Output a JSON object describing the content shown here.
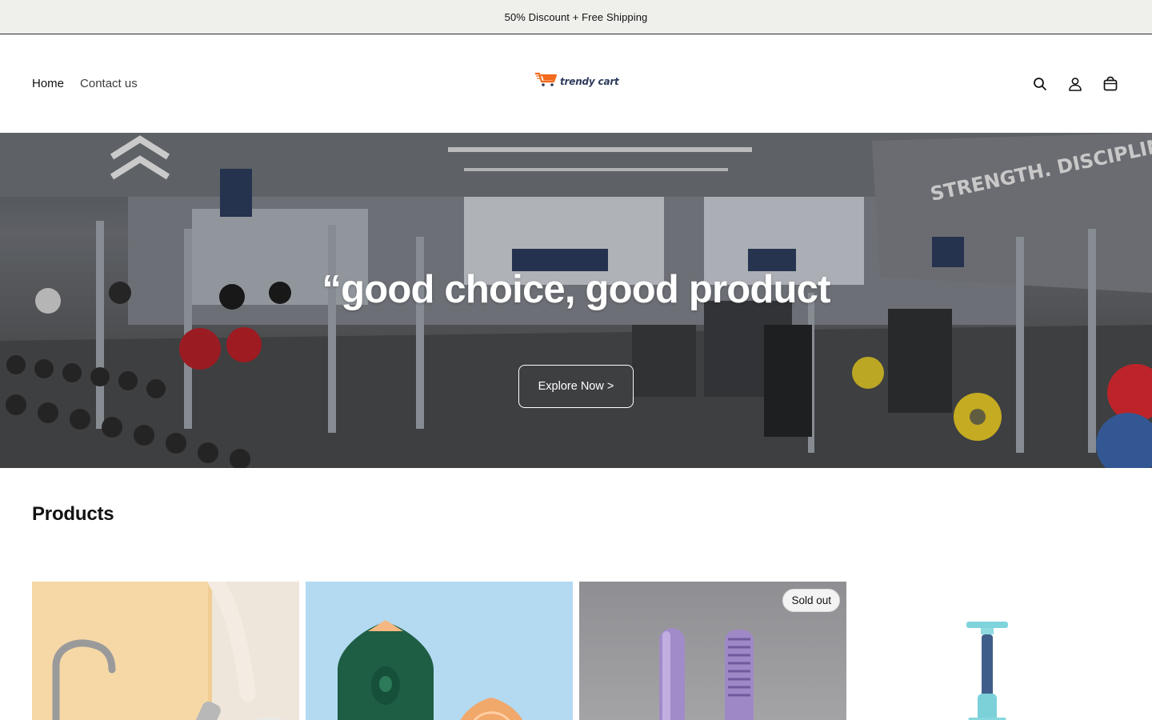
{
  "announcement": {
    "text": "50% Discount + Free Shipping"
  },
  "header": {
    "nav": [
      {
        "label": "Home"
      },
      {
        "label": "Contact us"
      }
    ],
    "logo_text": "trendy cart",
    "icons": [
      "search-icon",
      "account-icon",
      "cart-icon"
    ]
  },
  "hero": {
    "heading": "“good choice, good product",
    "button_label": "Explore Now >"
  },
  "products": {
    "title": "Products",
    "items": [
      {
        "image": "kitchen-sink-cleaning-product",
        "badge": ""
      },
      {
        "image": "green-steam-iron-product",
        "badge": ""
      },
      {
        "image": "purple-hair-straightener-comb-product",
        "badge": "Sold out"
      },
      {
        "image": "blue-handheld-device-product",
        "badge": ""
      }
    ]
  },
  "colors": {
    "announcement_bg": "#eff0ec",
    "text": "#121212",
    "logo_orange": "#f26a1b",
    "logo_navy": "#2d3a5c"
  }
}
